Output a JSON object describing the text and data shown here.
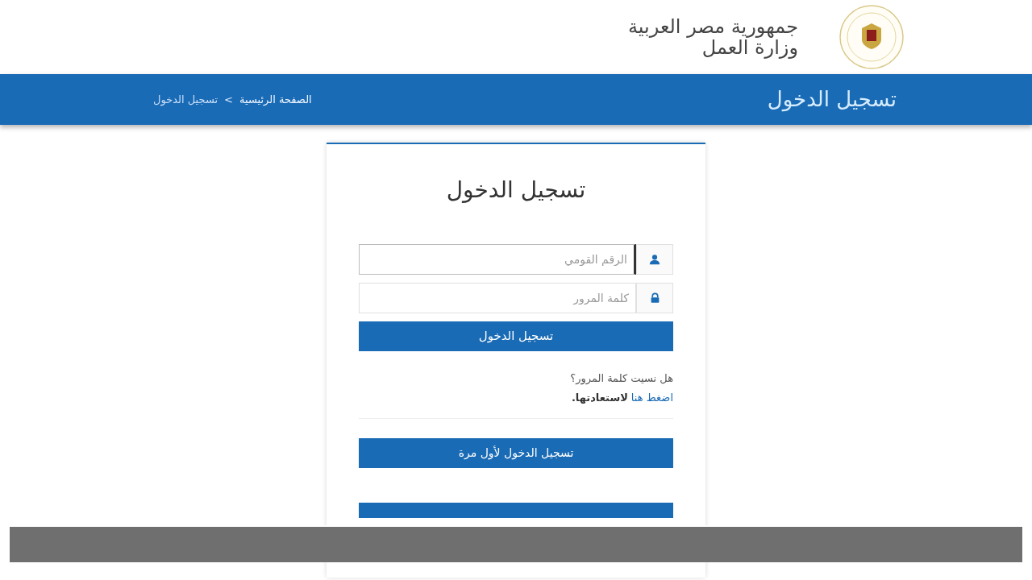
{
  "header": {
    "title_line_1": "جمهورية مصر العربية",
    "title_line_2": "وزارة العمل"
  },
  "banner": {
    "title": "تسجيل الدخول",
    "breadcrumb": [
      {
        "label": "الصفحة الرئيسية",
        "kind": "link"
      },
      {
        "label": "تسجيل الدخول",
        "kind": "current"
      }
    ],
    "separator": ">"
  },
  "login": {
    "title": "تسجيل الدخول",
    "fields": [
      {
        "kind": "user",
        "placeholder": "الرقم القومي",
        "focused": true
      },
      {
        "kind": "lock",
        "placeholder": "كلمة المرور",
        "focused": false
      }
    ],
    "submit": "تسجيل الدخول",
    "forgot_question": "هل نسيت كلمة المرور؟",
    "forgot_link": "اضغط هنا",
    "forgot_rest": "لاستعادتها.",
    "buttons": [
      {
        "label": "تسجيل الدخول لأول مرة"
      }
    ]
  }
}
